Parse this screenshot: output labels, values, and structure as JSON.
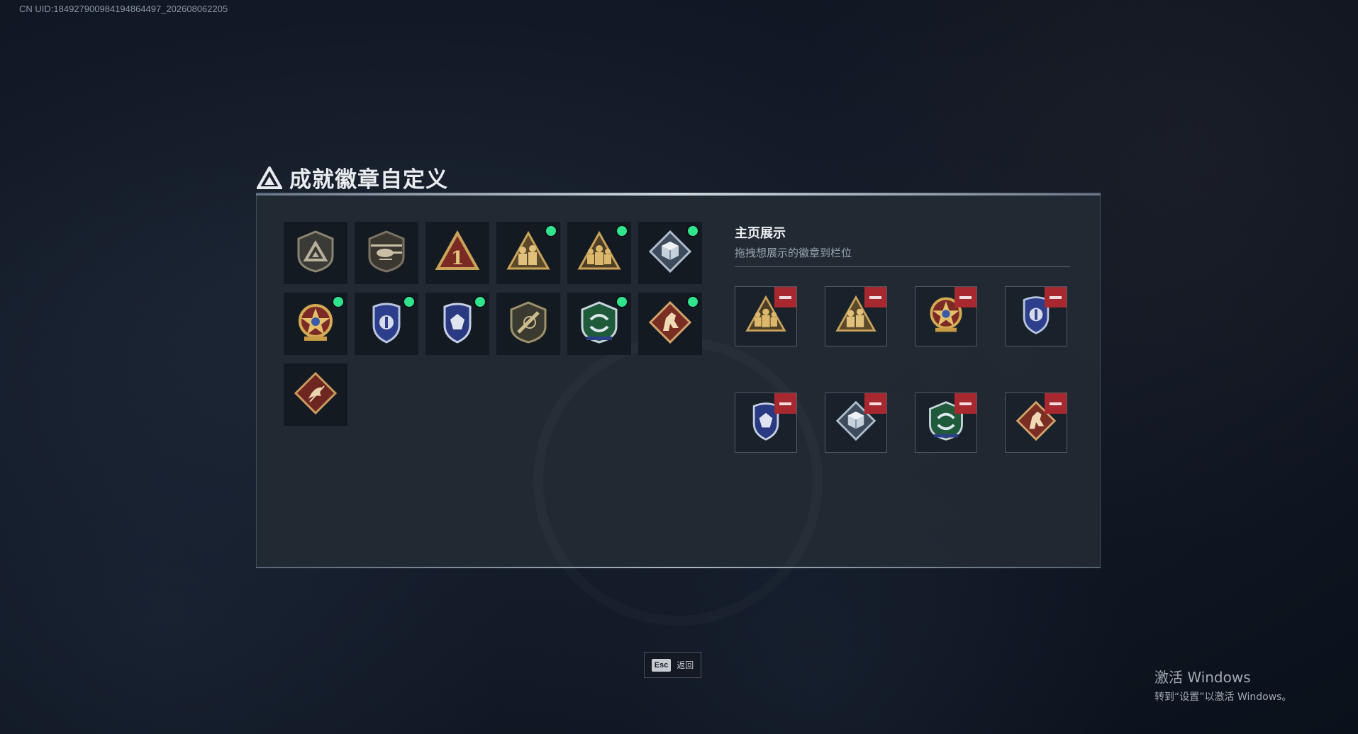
{
  "watermark_uid": "CN UID:184927900984194864497_202608062205",
  "title": "成就徽章自定义",
  "display": {
    "title": "主页展示",
    "subtitle": "拖拽想展示的徽章到栏位"
  },
  "inventory": [
    {
      "icon": "shield-triangle-emblem",
      "new": false
    },
    {
      "icon": "helicopter-emblem",
      "new": false
    },
    {
      "icon": "rank-one-triangle-emblem",
      "new": false
    },
    {
      "icon": "gold-soldiers-triangle-emblem",
      "new": true
    },
    {
      "icon": "gold-squad-triangle-emblem",
      "new": true
    },
    {
      "icon": "silver-cube-diamond-emblem",
      "new": true
    },
    {
      "icon": "gold-star-medal-emblem",
      "new": true
    },
    {
      "icon": "blue-police-badge-emblem",
      "new": true
    },
    {
      "icon": "blue-crest-badge-emblem",
      "new": true
    },
    {
      "icon": "rifle-shield-emblem",
      "new": false
    },
    {
      "icon": "green-arrows-shield-emblem",
      "new": true
    },
    {
      "icon": "red-horse-diamond-emblem",
      "new": true
    },
    {
      "icon": "red-scroll-diamond-emblem",
      "new": false
    }
  ],
  "showcase": [
    {
      "icon": "gold-squad-triangle-emblem"
    },
    {
      "icon": "gold-soldiers-triangle-emblem"
    },
    {
      "icon": "gold-star-medal-emblem"
    },
    {
      "icon": "blue-police-badge-emblem"
    },
    {
      "icon": "blue-crest-badge-emblem"
    },
    {
      "icon": "silver-cube-diamond-emblem"
    },
    {
      "icon": "green-arrows-shield-emblem"
    },
    {
      "icon": "red-horse-diamond-emblem"
    }
  ],
  "esc": {
    "key": "Esc",
    "label": "返回"
  },
  "activation": {
    "line1": "激活 Windows",
    "line2": "转到“设置”以激活 Windows。"
  },
  "colors": {
    "new_indicator": "#2fe48c",
    "remove_button": "#a8282f",
    "panel_bg": "#222a34"
  }
}
